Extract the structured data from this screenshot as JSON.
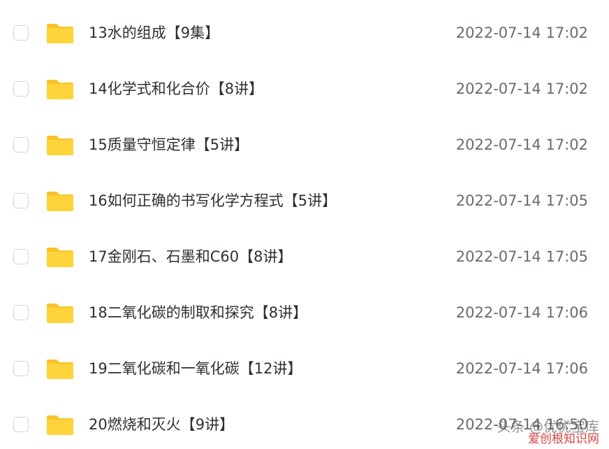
{
  "files": [
    {
      "name": "13水的组成【9集】",
      "date": "2022-07-14 17:02"
    },
    {
      "name": "14化学式和化合价【8讲】",
      "date": "2022-07-14 17:02"
    },
    {
      "name": "15质量守恒定律【5讲】",
      "date": "2022-07-14 17:02"
    },
    {
      "name": "16如何正确的书写化学方程式【5讲】",
      "date": "2022-07-14 17:05"
    },
    {
      "name": "17金刚石、石墨和C60【8讲】",
      "date": "2022-07-14 17:05"
    },
    {
      "name": "18二氧化碳的制取和探究【8讲】",
      "date": "2022-07-14 17:06"
    },
    {
      "name": "19二氧化碳和一氧化碳【12讲】",
      "date": "2022-07-14 17:06"
    },
    {
      "name": "20燃烧和灭火【9讲】",
      "date": "2022-07-14 16:50"
    }
  ],
  "watermark": {
    "author": "头条 @优优宝库",
    "site": "爱创根知识网"
  },
  "colors": {
    "folder": "#FFD43B",
    "folder_tab": "#F7C52B",
    "checkbox_border": "#CFD3DA",
    "name_text": "#2B2F36",
    "date_text": "#666B73"
  },
  "icons": {
    "folder": "folder-icon",
    "checkbox": "checkbox-icon"
  }
}
